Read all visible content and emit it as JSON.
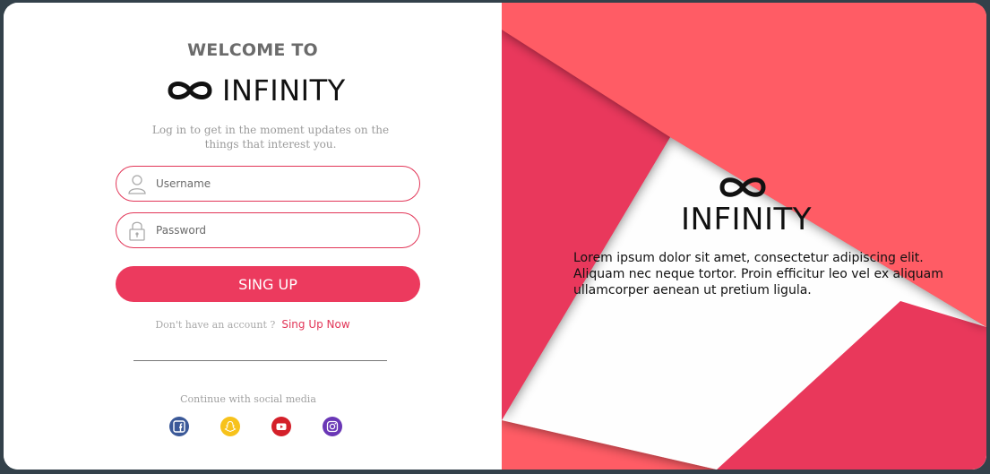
{
  "login": {
    "welcome": "WELCOME TO",
    "brand": "INFINITY",
    "tagline": "Log in to get in the moment updates on the things that interest you.",
    "username_placeholder": "Username",
    "password_placeholder": "Password",
    "submit_label": "SING UP",
    "account_question": "Don't have an account ?",
    "signup_link": "Sing Up Now",
    "social_label": "Continue with social media",
    "social_icons": [
      "facebook-icon",
      "snapchat-icon",
      "youtube-icon",
      "instagram-icon"
    ]
  },
  "promo": {
    "brand": "INFINITY",
    "description": "Lorem ipsum dolor sit amet, consectetur adipiscing elit. Aliquam nec neque tortor. Proin efficitur leo vel ex aliquam ullamcorper aenean ut pretium ligula."
  },
  "colors": {
    "accent": "#ec3a5e",
    "coral": "#ff5a64",
    "background": "#33414a"
  }
}
